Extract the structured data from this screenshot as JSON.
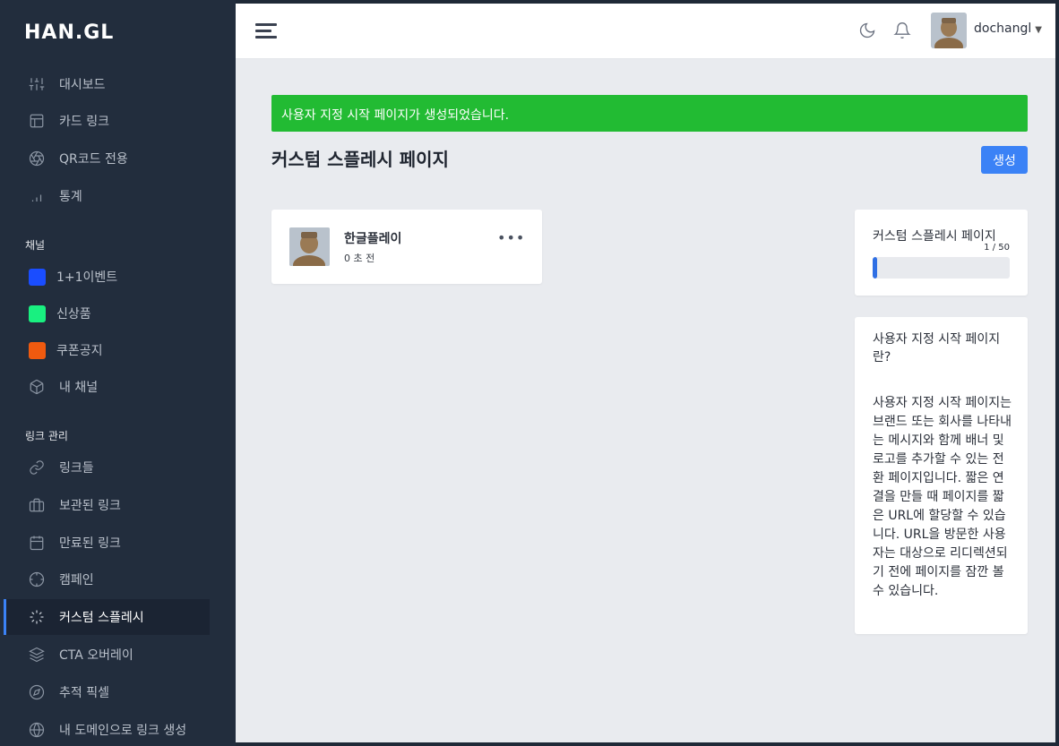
{
  "brand": {
    "logo_text": "HAN.GL"
  },
  "sidebar": {
    "main_items": [
      {
        "label": "대시보드",
        "icon": "sliders-icon"
      },
      {
        "label": "카드 링크",
        "icon": "layout-icon"
      },
      {
        "label": "QR코드 전용",
        "icon": "aperture-icon"
      },
      {
        "label": "통계",
        "icon": "bar-chart-icon"
      }
    ],
    "channels_label": "채널",
    "channels": [
      {
        "label": "1+1이벤트",
        "color": "#1a4dff"
      },
      {
        "label": "신상품",
        "color": "#19f080"
      },
      {
        "label": "쿠폰공지",
        "color": "#f05a0f"
      },
      {
        "label": "내 채널",
        "icon": "box-icon"
      }
    ],
    "links_label": "링크 관리",
    "link_items": [
      {
        "label": "링크들",
        "icon": "link-icon"
      },
      {
        "label": "보관된 링크",
        "icon": "briefcase-icon"
      },
      {
        "label": "만료된 링크",
        "icon": "calendar-icon"
      },
      {
        "label": "캠페인",
        "icon": "crosshair-icon"
      },
      {
        "label": "커스텀 스플레시",
        "icon": "loader-icon",
        "active": true
      },
      {
        "label": "CTA 오버레이",
        "icon": "layers-icon"
      },
      {
        "label": "추적 픽셀",
        "icon": "compass-icon"
      },
      {
        "label": "내 도메인으로 링크 생성",
        "icon": "globe-icon"
      }
    ]
  },
  "topbar": {
    "username": "dochangl",
    "icons": [
      "menu-icon",
      "moon-icon",
      "bell-icon",
      "chevron-down-icon"
    ]
  },
  "alert": {
    "message": "사용자 지정 시작 페이지가 생성되었습니다.",
    "color": "#22bb33"
  },
  "page": {
    "title": "커스텀 스플레시 페이지",
    "create_label": "생성"
  },
  "items": [
    {
      "name": "한글플레이",
      "time": "0 초 전",
      "more_label": "•••"
    }
  ],
  "usage": {
    "title": "커스텀 스플레시 페이지",
    "count_text": "1 / 50",
    "used": 1,
    "limit": 50
  },
  "info": {
    "title": "사용자 지정 시작 페이지란?",
    "body": "사용자 지정 시작 페이지는 브랜드 또는 회사를 나타내는 메시지와 함께 배너 및 로고를 추가할 수 있는 전환 페이지입니다. 짧은 연결을 만들 때 페이지를 짧은 URL에 할당할 수 있습니다. URL을 방문한 사용자는 대상으로 리디렉션되기 전에 페이지를 잠깐 볼 수 있습니다."
  }
}
